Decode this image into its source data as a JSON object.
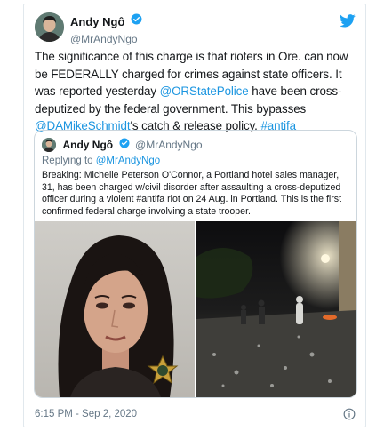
{
  "author": {
    "name": "Andy Ngô",
    "handle": "@MrAndyNgo"
  },
  "tweet": {
    "part1": "The significance of this charge is that rioters in Ore. can now be FEDERALLY charged for crimes against state officers. It was reported yesterday ",
    "mention1": "@ORStatePolice",
    "part2": " have been cross-deputized by the federal government. This bypasses ",
    "mention2": "@DAMikeSchmidt",
    "part3": "'s catch & release policy. ",
    "hashtag": "#antifa"
  },
  "quoted": {
    "name": "Andy Ngô",
    "handle": "@MrAndyNgo",
    "reply_prefix": "Replying to ",
    "reply_handle": "@MrAndyNgo",
    "text": "Breaking: Michelle Peterson O'Connor, a Portland hotel sales manager, 31, has been charged w/civil disorder after assaulting a cross-deputized officer during a violent #antifa riot on 24 Aug. in Portland. This is the first confirmed federal charge involving a state trooper."
  },
  "timestamp": "6:15 PM - Sep 2, 2020",
  "icons": {
    "brand": "twitter-bird-icon",
    "verified": "verified-badge-icon",
    "info": "info-icon"
  },
  "colors": {
    "link": "#1b95e0",
    "text": "#14171a",
    "secondary": "#657786",
    "border": "#e1e8ed"
  }
}
